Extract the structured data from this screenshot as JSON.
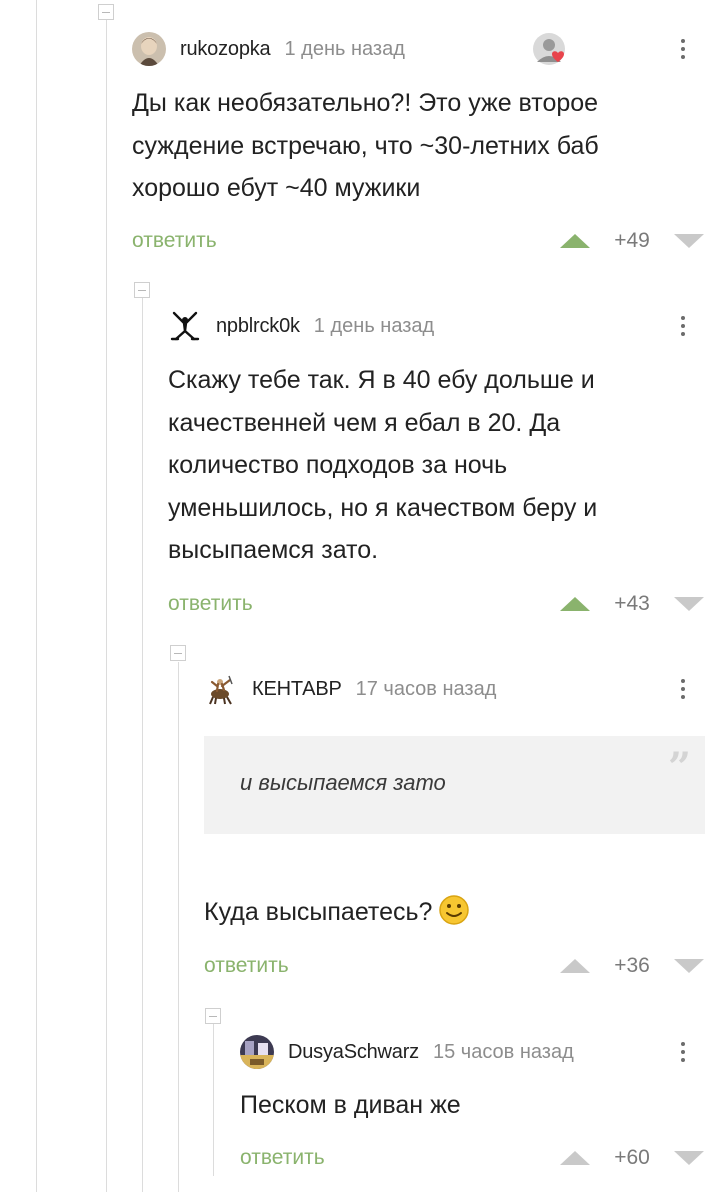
{
  "comments": [
    {
      "author": "rukozopka",
      "time": "1 день назад",
      "text_lines": [
        "Ды как необязательно?! Это уже второе",
        "суждение встречаю, что ~30-летних баб",
        "хорошо ебут ~40 мужики"
      ],
      "reply_label": "ответить",
      "score": "+49",
      "upvoted": true
    },
    {
      "author": "npblrck0k",
      "time": "1 день назад",
      "text_lines": [
        "Скажу тебе так. Я в 40 ебу дольше и",
        "качественней чем я ебал в 20. Да",
        "количество подходов за ночь",
        "уменьшилось, но я качеством беру и",
        "высыпаемся зато."
      ],
      "reply_label": "ответить",
      "score": "+43",
      "upvoted": true
    },
    {
      "author": "КЕНТАВР",
      "time": "17 часов назад",
      "quote": "и высыпаемся зато",
      "text": "Куда высыпаетесь?",
      "reply_label": "ответить",
      "score": "+36",
      "upvoted": false
    },
    {
      "author": "DusyaSchwarz",
      "time": "15 часов назад",
      "text": "Песком в диван же",
      "reply_label": "ответить",
      "score": "+60",
      "upvoted": false
    }
  ],
  "colors": {
    "reply_green": "#8ab36d",
    "upvote_active": "#8ab36d",
    "vote_inactive": "#c9c9c9",
    "quote_bg": "#f2f2f2"
  },
  "icons": [
    "more-icon",
    "upvote-icon",
    "downvote-icon",
    "collapse-icon",
    "quote-icon",
    "smiley-icon"
  ]
}
